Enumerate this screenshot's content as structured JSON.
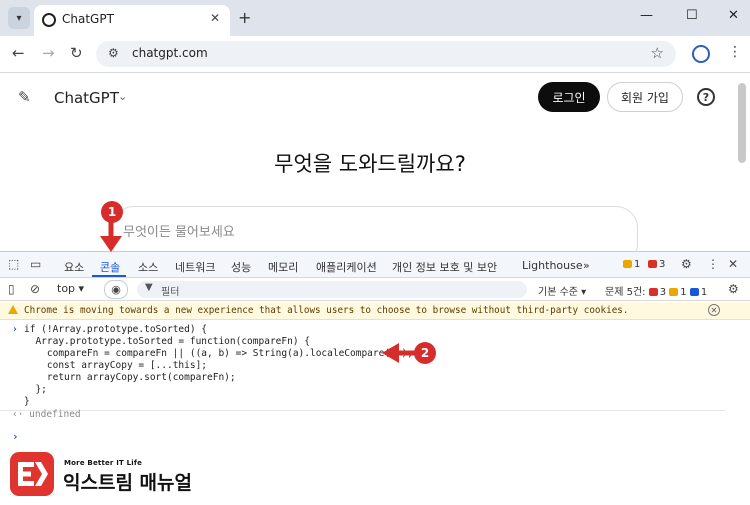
{
  "browser": {
    "tab_title": "ChatGPT",
    "url": "chatgpt.com"
  },
  "page": {
    "brand": "ChatGPT",
    "login_label": "로그인",
    "signup_label": "회원 가입",
    "help_label": "?",
    "hero": "무엇을 도와드릴까요?",
    "prompt_placeholder": "무엇이든 물어보세요"
  },
  "devtools": {
    "tabs": [
      "요소",
      "콘솔",
      "소스",
      "네트워크",
      "성능",
      "메모리",
      "애플리케이션",
      "개인 정보 보호 및 보안",
      "Lighthouse"
    ],
    "active_tab": "콘솔",
    "badges": {
      "warnings": "1",
      "errors": "3"
    },
    "context": "top",
    "filter_placeholder": "필터",
    "levels": "기본 수준",
    "issues_label": "문제 5건:",
    "issue_counts": {
      "errors": "3",
      "warnings": "1",
      "info": "1"
    },
    "warning_text": "Chrome is moving towards a new experience that allows users to choose to browse without third-party cookies.",
    "code_lines": [
      "if (!Array.prototype.toSorted) {",
      "  Array.prototype.toSorted = function(compareFn) {",
      "    compareFn = compareFn || ((a, b) => String(a).localeCompare(b));",
      "    const arrayCopy = [...this];",
      "    return arrayCopy.sort(compareFn);",
      "  };",
      "}"
    ],
    "result": "undefined"
  },
  "annotations": {
    "step1": "1",
    "step2": "2"
  },
  "watermark": {
    "tagline": "More Better IT Life",
    "name": "익스트림 매뉴얼"
  },
  "colors": {
    "accent": "#1a57d6",
    "annotation_red": "#d62c2c",
    "warning_bg": "#fff9e0",
    "logo_red": "#e0342f"
  }
}
